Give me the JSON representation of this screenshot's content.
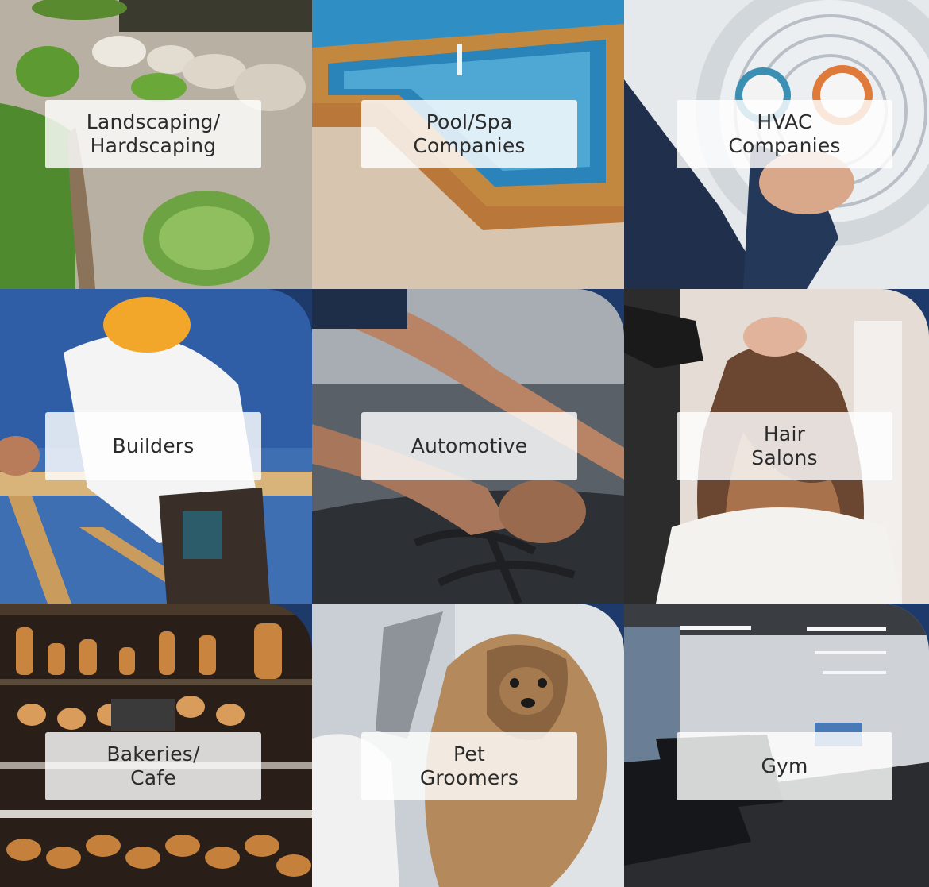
{
  "tiles": [
    {
      "id": "landscaping",
      "lines": [
        "Landscaping/",
        "Hardscaping"
      ]
    },
    {
      "id": "pool-spa",
      "lines": [
        "Pool/Spa",
        "Companies"
      ]
    },
    {
      "id": "hvac",
      "lines": [
        "HVAC",
        "Companies"
      ]
    },
    {
      "id": "builders",
      "lines": [
        "Builders"
      ]
    },
    {
      "id": "automotive",
      "lines": [
        "Automotive"
      ]
    },
    {
      "id": "hair-salons",
      "lines": [
        "Hair",
        "Salons"
      ]
    },
    {
      "id": "bakeries-cafe",
      "lines": [
        "Bakeries/",
        "Cafe"
      ]
    },
    {
      "id": "pet-groomers",
      "lines": [
        "Pet",
        "Groomers"
      ]
    },
    {
      "id": "gym",
      "lines": [
        "Gym"
      ]
    }
  ],
  "colors": {
    "background": "#1e3a6b",
    "label_bg": "#ffffff",
    "label_text": "#2b2b2b"
  }
}
